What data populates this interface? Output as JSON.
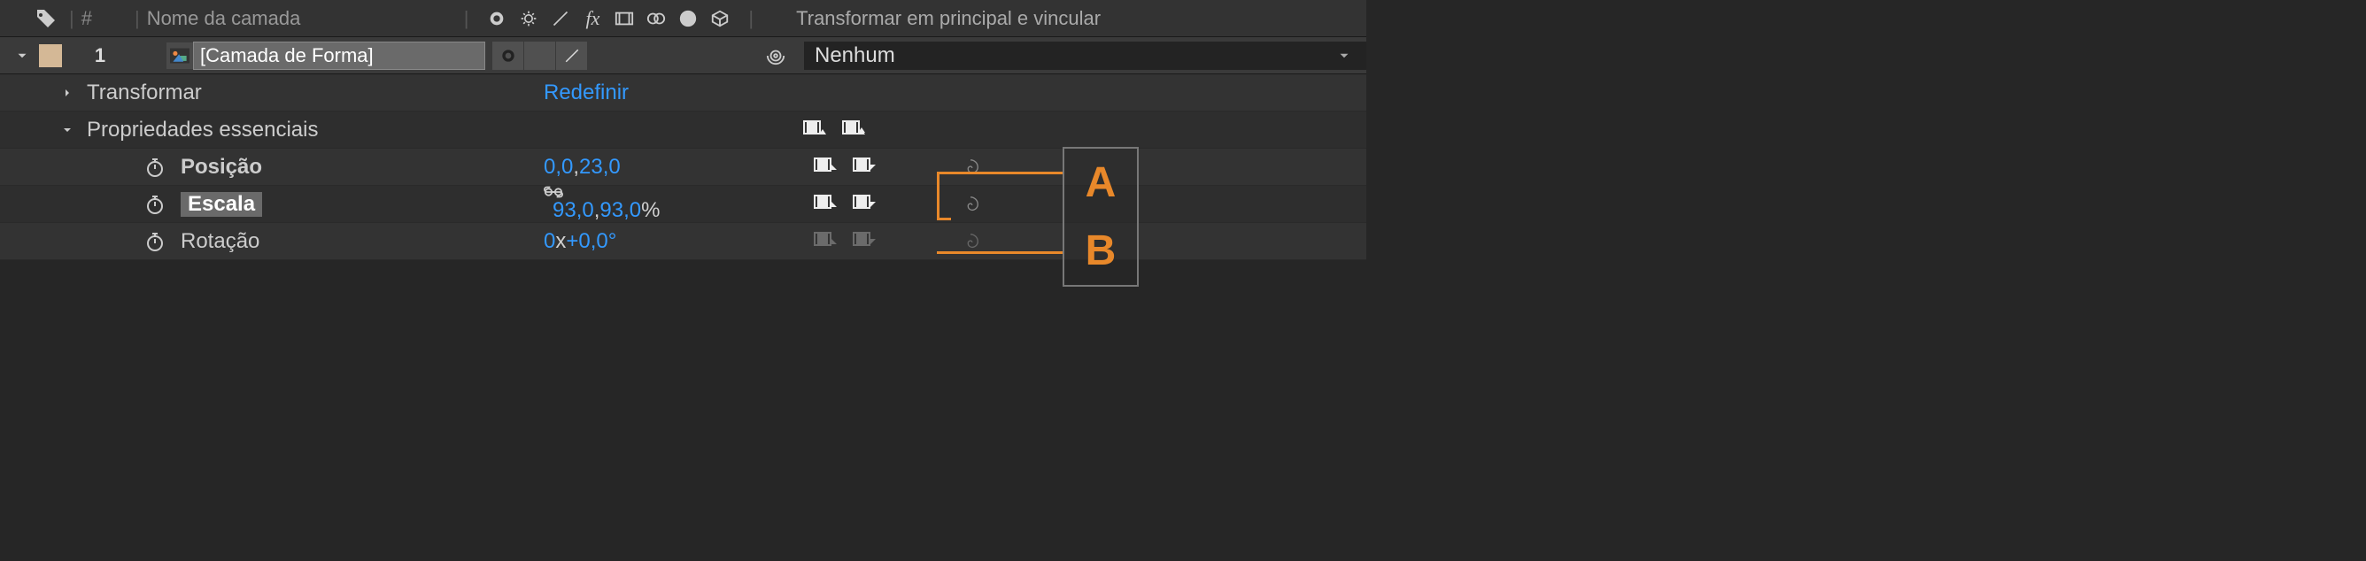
{
  "header": {
    "hash": "#",
    "layer_name_label": "Nome da camada",
    "parent_label": "Transformar em principal e vincular"
  },
  "layer": {
    "number": "1",
    "name": "[Camada de Forma]",
    "parent": "Nenhum"
  },
  "transform": {
    "label": "Transformar",
    "reset": "Redefinir"
  },
  "essential": {
    "label": "Propriedades essenciais"
  },
  "props": {
    "position": {
      "label": "Posição",
      "x": "0,0",
      "y": "23,0"
    },
    "scale": {
      "label": "Escala",
      "x": "93,0",
      "y": "93,0",
      "suffix": "%"
    },
    "rotation": {
      "label": "Rotação",
      "turns": "0",
      "deg": "+0,0°"
    }
  },
  "callouts": {
    "a": "A",
    "b": "B"
  }
}
